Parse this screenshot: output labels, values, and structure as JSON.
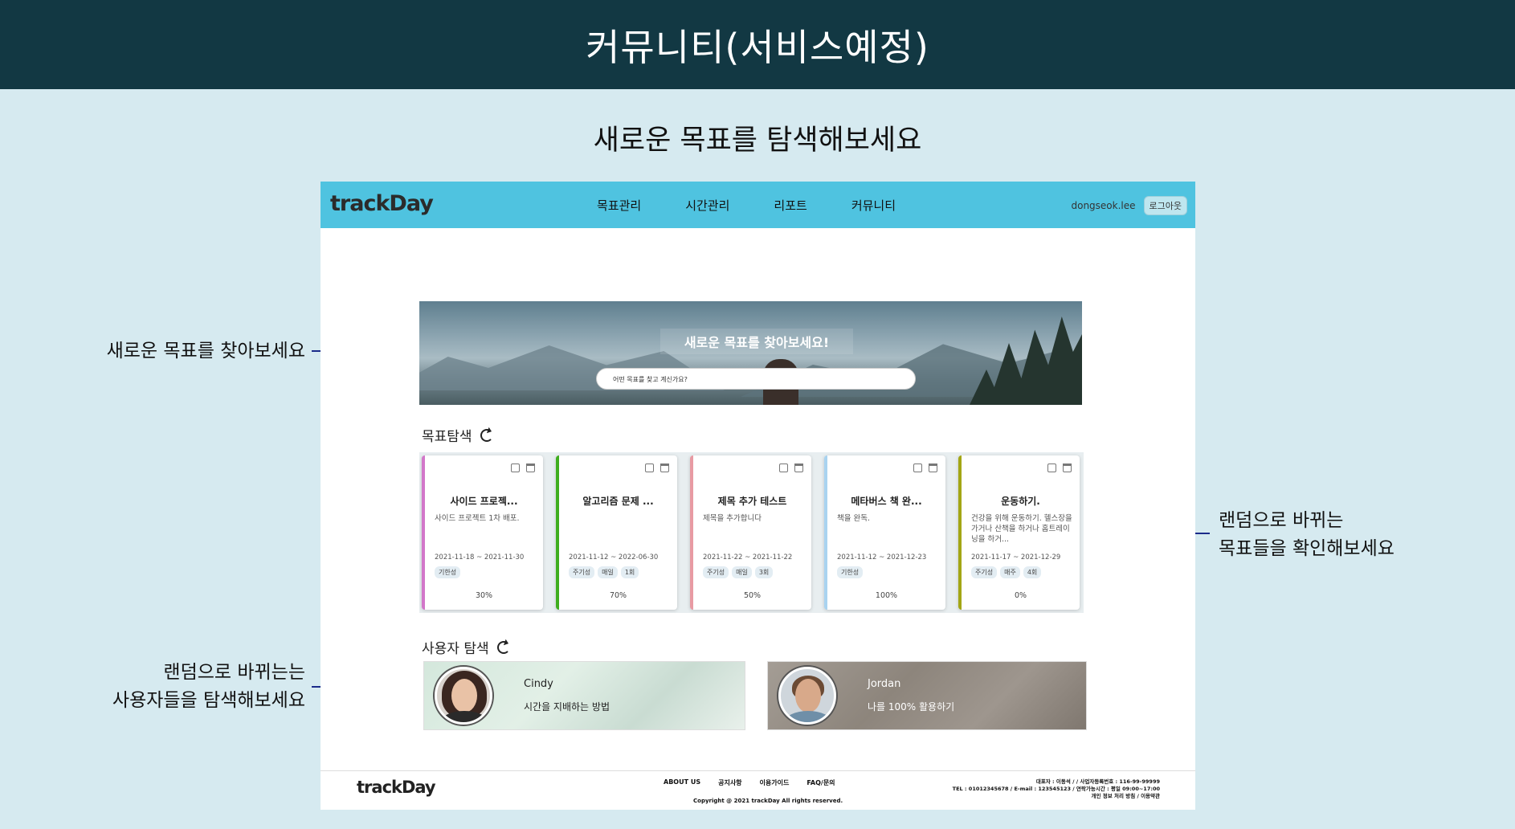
{
  "banner": {
    "title": "커뮤니티(서비스예정)"
  },
  "subtitle": "새로운 목표를 탐색해보세요",
  "annotations": {
    "search": "새로운 목표를 찾아보세요",
    "goals_line1": "랜덤으로 바뀌는",
    "goals_line2": "목표들을 확인해보세요",
    "users_line1": "랜덤으로 바뀌는는",
    "users_line2": "사용자들을 탐색해보세요"
  },
  "app": {
    "logo": "trackDay",
    "nav": [
      "목표관리",
      "시간관리",
      "리포트",
      "커뮤니티"
    ],
    "username": "dongseok.lee",
    "logout": "로그아웃",
    "accent": "#4fc3e0"
  },
  "hero": {
    "title": "새로운 목표를 찾아보세요!",
    "search_placeholder": "어떤 목표를 찾고 계신가요?"
  },
  "goal_section": {
    "title": "목표탐색"
  },
  "goals": [
    {
      "title": "사이드 프로젝...",
      "desc": "사이드 프로젝트 1차 배포.",
      "date": "2021-11-18 ~ 2021-11-30",
      "tags": [
        "기한성"
      ],
      "progress": "30%",
      "color": "#d277c9"
    },
    {
      "title": "알고리즘 문제 ...",
      "desc": "",
      "date": "2021-11-12 ~ 2022-06-30",
      "tags": [
        "주기성",
        "매일",
        "1회"
      ],
      "progress": "70%",
      "color": "#3fae1e"
    },
    {
      "title": "제목 추가 테스트",
      "desc": "제목을 추가합니다",
      "date": "2021-11-22 ~ 2021-11-22",
      "tags": [
        "주기성",
        "매일",
        "3회"
      ],
      "progress": "50%",
      "color": "#e89aa3"
    },
    {
      "title": "메타버스 책 완...",
      "desc": "책을 완독.",
      "date": "2021-11-12 ~ 2021-12-23",
      "tags": [
        "기한성"
      ],
      "progress": "100%",
      "color": "#a9d3f0"
    },
    {
      "title": "운동하기.",
      "desc": "건강을 위해 운동하기. 헬스장을 가거나 산책을 하거나 홈트레이닝을 하거...",
      "date": "2021-11-17 ~ 2021-12-29",
      "tags": [
        "주기성",
        "매주",
        "4회"
      ],
      "progress": "0%",
      "color": "#a3a614"
    }
  ],
  "user_section": {
    "title": "사용자 탐색"
  },
  "users": [
    {
      "name": "Cindy",
      "motto": "시간을 지배하는 방법"
    },
    {
      "name": "Jordan",
      "motto": "나를 100% 활용하기"
    }
  ],
  "footer": {
    "logo": "trackDay",
    "links": [
      "ABOUT US",
      "공지사항",
      "이용가이드",
      "FAQ/문의"
    ],
    "copyright": "Copyright @ 2021 trackDay All rights reserved.",
    "info1": "대표자 : 이동석 / / 사업자등록번호 : 116-99-99999",
    "info2": "TEL : 01012345678 / E-mail : 123545123 / 연락가능시간 : 평일 09:00~17:00",
    "info3": "개인 정보 처리 방침 / 이용약관"
  }
}
